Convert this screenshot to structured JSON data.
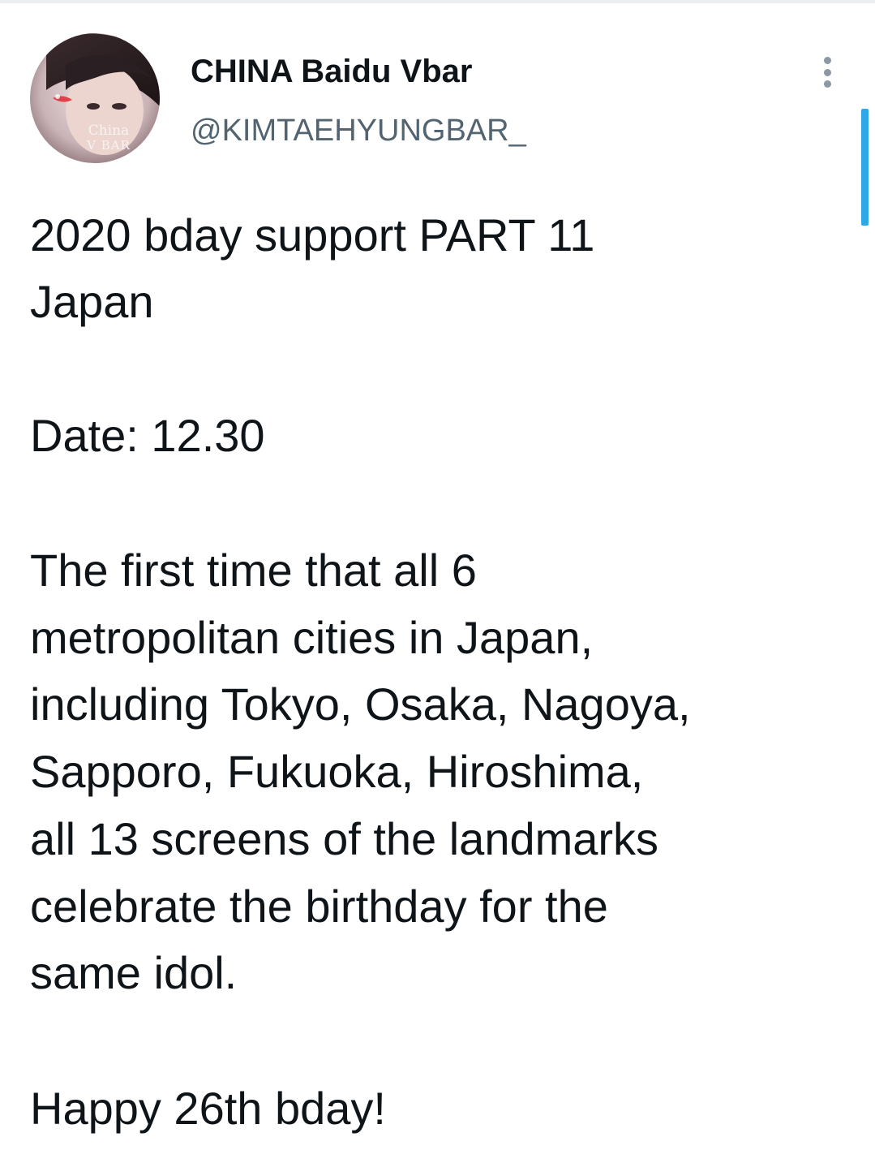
{
  "account": {
    "display_name": "CHINA Baidu Vbar",
    "handle": "@KIMTAEHYUNGBAR_",
    "avatar_text": "China V BAR"
  },
  "tweet": {
    "lines": [
      "2020 bday support PART 11",
      "Japan",
      "Date: 12.30",
      "The first time that all 6",
      "metropolitan cities in Japan,",
      "including Tokyo, Osaka, Nagoya,",
      "Sapporo, Fukuoka, Hiroshima,",
      "all 13 screens of the landmarks",
      "celebrate the birthday for the",
      "same idol.",
      "Happy 26th bday!"
    ]
  },
  "icons": {
    "more": "more-vertical-icon"
  },
  "colors": {
    "text": "#0f1419",
    "secondary_text": "#536471",
    "scrollbar": "#2ea8e6"
  }
}
